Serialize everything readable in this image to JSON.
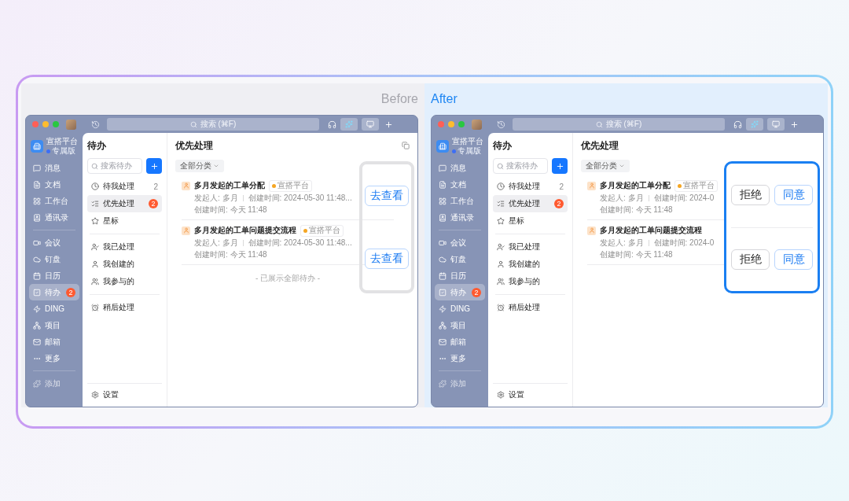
{
  "panels": [
    {
      "kind": "before",
      "label": "Before",
      "window": {
        "search": "搜索 (⌘F)",
        "team": {
          "name": "宣搭平台",
          "edition": "专属版"
        },
        "nav": [
          [
            {
              "label": "消息",
              "selected": false,
              "disabled": false
            },
            {
              "label": "文档",
              "selected": false,
              "disabled": false
            },
            {
              "label": "工作台",
              "selected": false,
              "disabled": false
            },
            {
              "label": "通讯录",
              "selected": false,
              "disabled": false
            }
          ],
          [
            {
              "label": "会议",
              "selected": false,
              "disabled": false
            },
            {
              "label": "钉盘",
              "selected": false,
              "disabled": false
            },
            {
              "label": "日历",
              "selected": false,
              "disabled": false
            },
            {
              "label": "待办",
              "selected": true,
              "disabled": false,
              "badge": "2"
            },
            {
              "label": "DING",
              "selected": false,
              "disabled": false
            },
            {
              "label": "项目",
              "selected": false,
              "disabled": false
            },
            {
              "label": "邮箱",
              "selected": false,
              "disabled": false
            },
            {
              "label": "更多",
              "selected": false,
              "disabled": false
            }
          ],
          [
            {
              "label": "添加",
              "selected": false,
              "disabled": true
            }
          ]
        ],
        "todo": {
          "title": "待办",
          "placeholder": "搜索待办",
          "groups": [
            [
              {
                "label": "待我处理",
                "selected": false,
                "count": "2"
              },
              {
                "label": "优先处理",
                "selected": true,
                "badge": "2"
              },
              {
                "label": "星标",
                "selected": false
              }
            ],
            [
              {
                "label": "我已处理",
                "selected": false
              },
              {
                "label": "我创建的",
                "selected": false
              },
              {
                "label": "我参与的",
                "selected": false
              }
            ],
            [
              {
                "label": "稍后处理",
                "selected": false
              }
            ]
          ],
          "settings": "设置"
        },
        "main": {
          "title": "优先处理",
          "filter": "全部分类",
          "tasks": [
            {
              "title": "多月发起的工单分配",
              "tag": "宣搭平台",
              "initiator": "发起人: 多月",
              "created": "创建时间: 2024-05-30 11:48...",
              "updated": "创建时间: 今天 11:48"
            },
            {
              "title": "多月发起的工单问题提交流程",
              "tag": "宣搭平台",
              "initiator": "发起人: 多月",
              "created": "创建时间: 2024-05-30 11:48...",
              "updated": "创建时间: 今天 11:48"
            }
          ],
          "footer": "- 已展示全部待办 -"
        }
      },
      "callout": {
        "kind": "outline",
        "groups": [
          [
            {
              "label": "去查看",
              "kind": "primary"
            }
          ],
          [
            {
              "label": "去查看",
              "kind": "primary"
            }
          ]
        ]
      }
    },
    {
      "kind": "after",
      "label": "After",
      "window": {
        "search": "搜索 (⌘F)",
        "team": {
          "name": "宣搭平台",
          "edition": "专属版"
        },
        "nav": [
          [
            {
              "label": "消息",
              "selected": false,
              "disabled": false
            },
            {
              "label": "文档",
              "selected": false,
              "disabled": false
            },
            {
              "label": "工作台",
              "selected": false,
              "disabled": false
            },
            {
              "label": "通讯录",
              "selected": false,
              "disabled": false
            }
          ],
          [
            {
              "label": "会议",
              "selected": false,
              "disabled": false
            },
            {
              "label": "钉盘",
              "selected": false,
              "disabled": false
            },
            {
              "label": "日历",
              "selected": false,
              "disabled": false
            },
            {
              "label": "待办",
              "selected": true,
              "disabled": false,
              "badge": "2"
            },
            {
              "label": "DING",
              "selected": false,
              "disabled": false
            },
            {
              "label": "项目",
              "selected": false,
              "disabled": false
            },
            {
              "label": "邮箱",
              "selected": false,
              "disabled": false
            },
            {
              "label": "更多",
              "selected": false,
              "disabled": false
            }
          ],
          [
            {
              "label": "添加",
              "selected": false,
              "disabled": true
            }
          ]
        ],
        "todo": {
          "title": "待办",
          "placeholder": "搜索待办",
          "groups": [
            [
              {
                "label": "待我处理",
                "selected": false,
                "count": "2"
              },
              {
                "label": "优先处理",
                "selected": true,
                "badge": "2"
              },
              {
                "label": "星标",
                "selected": false
              }
            ],
            [
              {
                "label": "我已处理",
                "selected": false
              },
              {
                "label": "我创建的",
                "selected": false
              },
              {
                "label": "我参与的",
                "selected": false
              }
            ],
            [
              {
                "label": "稍后处理",
                "selected": false
              }
            ]
          ],
          "settings": "设置"
        },
        "main": {
          "title": "优先处理",
          "filter": "全部分类",
          "tasks": [
            {
              "title": "多月发起的工单分配",
              "tag": "宣搭平台",
              "initiator": "发起人: 多月",
              "created": "创建时间: 2024-0",
              "updated": "创建时间: 今天 11:48"
            },
            {
              "title": "多月发起的工单问题提交流程",
              "initiator": "发起人: 多月",
              "created": "创建时间: 2024-0",
              "updated": "创建时间: 今天 11:48"
            }
          ]
        }
      },
      "callout": {
        "kind": "highlight",
        "groups": [
          [
            {
              "label": "拒绝",
              "kind": "default"
            },
            {
              "label": "同意",
              "kind": "primary"
            }
          ],
          [
            {
              "label": "拒绝",
              "kind": "default"
            },
            {
              "label": "同意",
              "kind": "primary"
            }
          ]
        ]
      }
    }
  ]
}
